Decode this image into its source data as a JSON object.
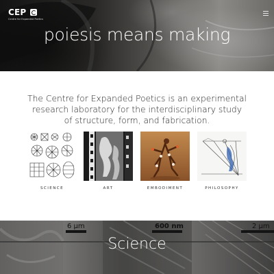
{
  "header": {
    "logo": {
      "wordmark": "CEP",
      "subtitle": "Centre for Expanded Poetics"
    },
    "menu_icon": "hamburger-icon",
    "hero_title": "poiesis means making"
  },
  "intro": {
    "text": "The Centre for Expanded Poetics is an experimental research laboratory for the interdisciplinary study of structure, form, and fabrication."
  },
  "categories": [
    {
      "label": "SCIENCE"
    },
    {
      "label": "ART"
    },
    {
      "label": "EMBODIMENT"
    },
    {
      "label": "PHILOSOPHY"
    }
  ],
  "science_section": {
    "title": "Science",
    "scale_labels": [
      "6 µm",
      "600 nm",
      "2 µm"
    ]
  },
  "colors": {
    "hero_text": "#ffffff",
    "body_text": "#222222",
    "caption_text": "#333333",
    "embodiment_bg": "#a86f3c"
  }
}
